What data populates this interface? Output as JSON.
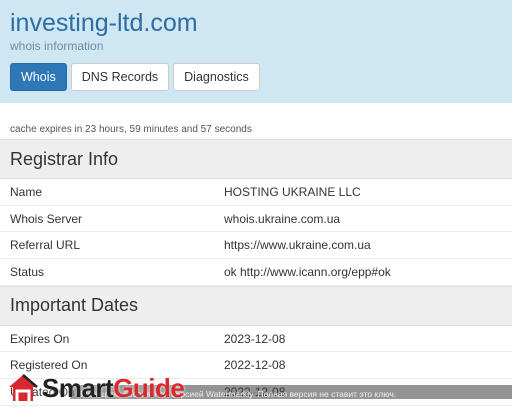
{
  "header": {
    "title": "investing-ltd.com",
    "subtitle": "whois information",
    "tabs": [
      {
        "label": "Whois",
        "active": true
      },
      {
        "label": "DNS Records",
        "active": false
      },
      {
        "label": "Diagnostics",
        "active": false
      }
    ]
  },
  "cache_note": "cache expires in 23 hours, 59 minutes and 57 seconds",
  "registrar": {
    "heading": "Registrar Info",
    "rows": [
      {
        "key": "Name",
        "value": "HOSTING UKRAINE LLC"
      },
      {
        "key": "Whois Server",
        "value": "whois.ukraine.com.ua"
      },
      {
        "key": "Referral URL",
        "value": "https://www.ukraine.com.ua"
      },
      {
        "key": "Status",
        "value": "ok http://www.icann.org/epp#ok"
      }
    ]
  },
  "dates": {
    "heading": "Important Dates",
    "rows": [
      {
        "key": "Expires On",
        "value": "2023-12-08"
      },
      {
        "key": "Registered On",
        "value": "2022-12-08"
      },
      {
        "key": "Updated On",
        "value": "2022-12-08"
      }
    ]
  },
  "watermark": {
    "brand_part1": "Smart",
    "brand_part2": "Guide",
    "note": "Защищено бесплатной версией Watermarkly. Полная версия не ставит это ключ.",
    "brand_red": "#d9282f"
  },
  "colors": {
    "header_bg": "#cfe7f3",
    "title": "#2d6ca2",
    "tab_active": "#2f78b8"
  }
}
